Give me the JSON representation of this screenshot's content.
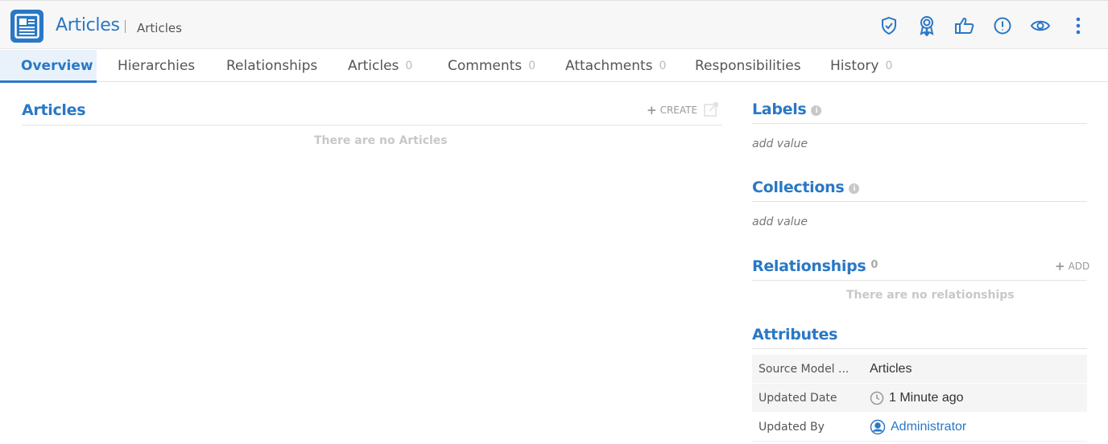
{
  "header": {
    "icon": "article-icon",
    "title": "Articles",
    "subtitle": "Articles",
    "actions": [
      {
        "name": "shield-check-icon"
      },
      {
        "name": "award-icon"
      },
      {
        "name": "thumbs-up-icon"
      },
      {
        "name": "alert-circle-icon"
      },
      {
        "name": "eye-icon"
      },
      {
        "name": "more-vertical-icon"
      }
    ]
  },
  "tabs": [
    {
      "label": "Overview",
      "count": ""
    },
    {
      "label": "Hierarchies",
      "count": ""
    },
    {
      "label": "Relationships",
      "count": ""
    },
    {
      "label": "Articles",
      "count": "0"
    },
    {
      "label": "Comments",
      "count": "0"
    },
    {
      "label": "Attachments",
      "count": "0"
    },
    {
      "label": "Responsibilities",
      "count": ""
    },
    {
      "label": "History",
      "count": "0"
    }
  ],
  "articles": {
    "title": "Articles",
    "create_label": "CREATE",
    "empty": "There are no Articles"
  },
  "labels": {
    "title": "Labels",
    "info": "i",
    "add": "add value"
  },
  "collections": {
    "title": "Collections",
    "info": "i",
    "add": "add value"
  },
  "relationships": {
    "title": "Relationships",
    "count": "0",
    "add_label": "ADD",
    "empty": "There are no relationships"
  },
  "attributes": {
    "title": "Attributes",
    "rows": [
      {
        "key": "Source Model ...",
        "value": "Articles"
      },
      {
        "key": "Updated Date",
        "value": "1 Minute ago"
      },
      {
        "key": "Updated By",
        "value": "Administrator"
      }
    ]
  },
  "colors": {
    "accent": "#2a78c5",
    "muted": "#c8c8c8"
  }
}
